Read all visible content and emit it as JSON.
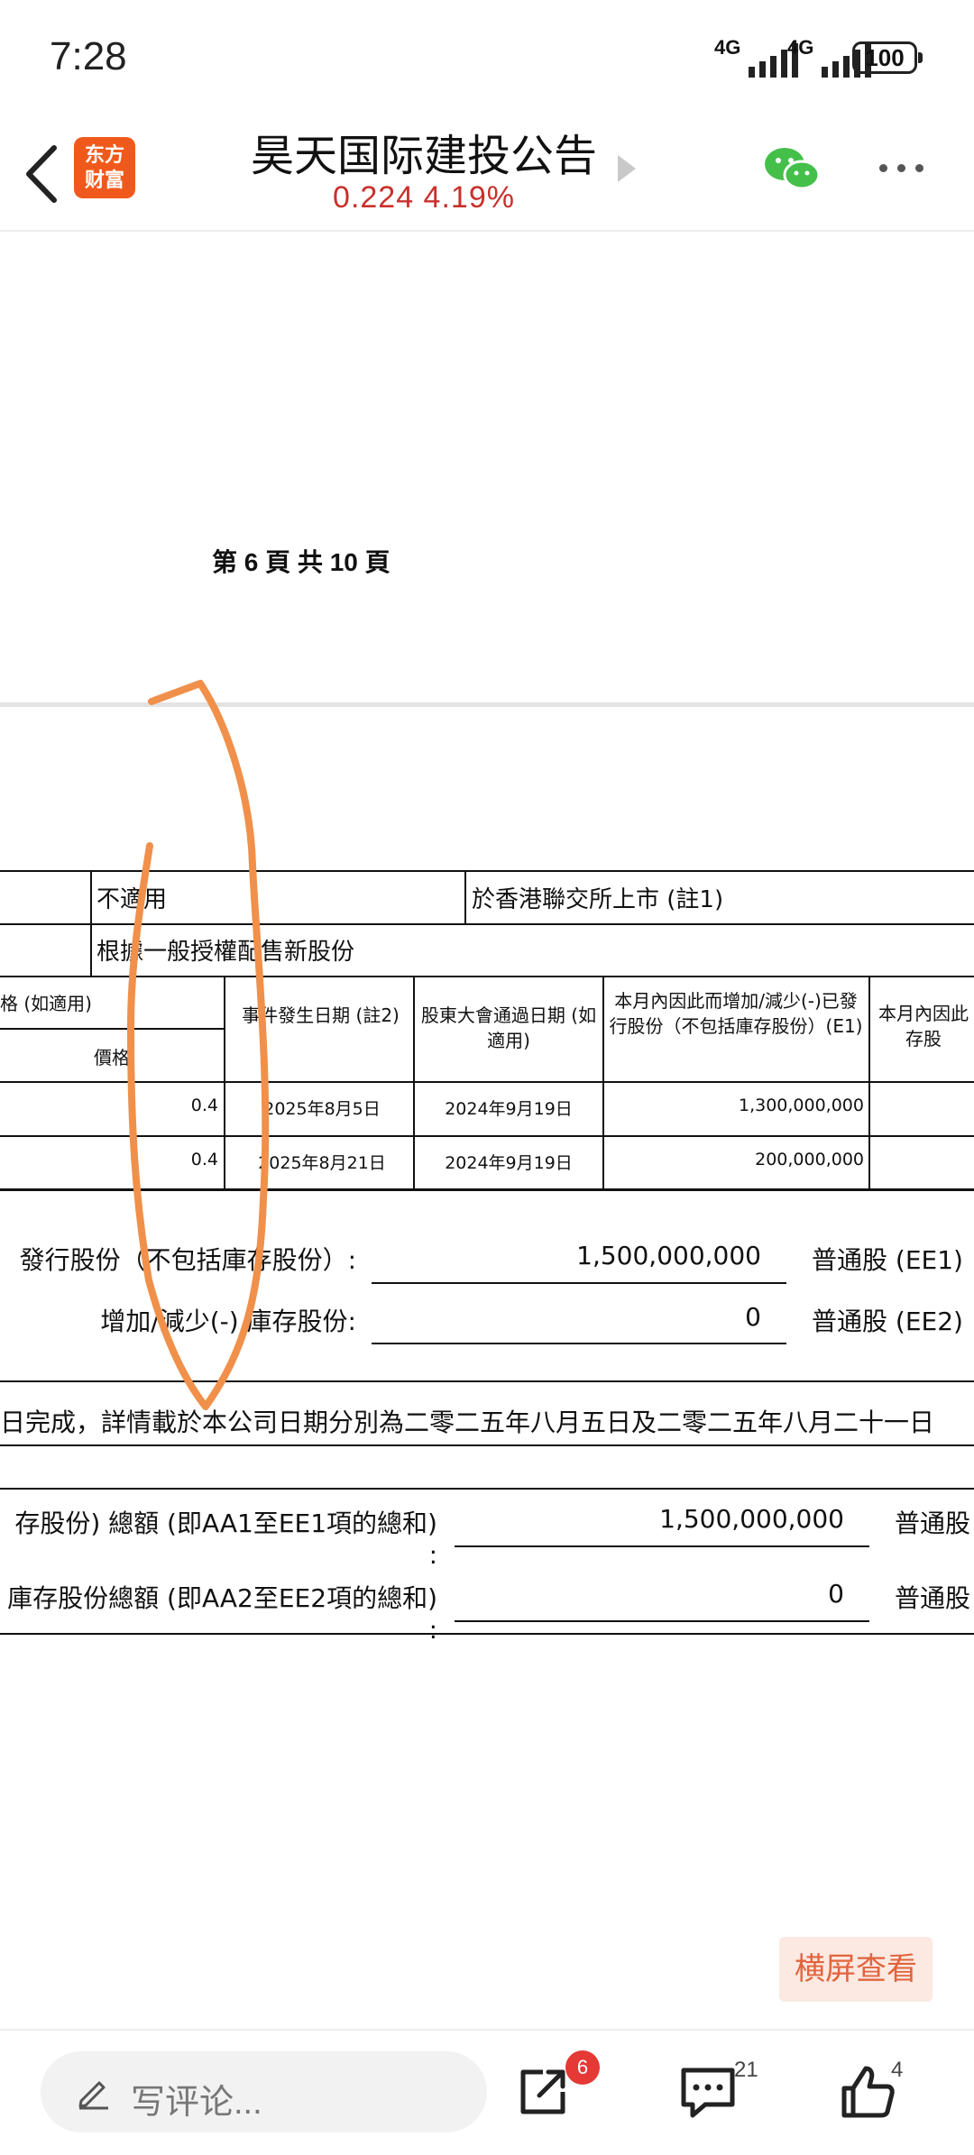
{
  "status_bar": {
    "time": "7:28",
    "signal1_label": "4G",
    "signal2_label": "4G",
    "battery": "100"
  },
  "header": {
    "logo_line1": "东方",
    "logo_line2": "财富",
    "title": "昊天国际建投公告",
    "quote": "0.224   4.19%"
  },
  "document": {
    "page_label": "第 6 頁 共 10 頁",
    "row1": {
      "a": "不適用",
      "b": "於香港聯交所上市 (註1)"
    },
    "row2": "根據一般授權配售新股份",
    "headers": {
      "price_group": "格 (如適用)",
      "price": "價格",
      "event_date": "事件發生日期 (註2)",
      "agm_date": "股東大會通過日期 (如適用)",
      "change": "本月內因此而增加/減少(-)已發行股份（不包括庫存股份）(E1)",
      "change_treasury": "本月內因此 存股"
    },
    "rows": [
      {
        "price": "0.4",
        "event_date": "2025年8月5日",
        "agm_date": "2024年9月19日",
        "change": "1,300,000,000"
      },
      {
        "price": "0.4",
        "event_date": "2025年8月21日",
        "agm_date": "2024年9月19日",
        "change": "200,000,000"
      }
    ],
    "totals": [
      {
        "label": "發行股份（不包括庫存股份）:",
        "value": "1,500,000,000",
        "unit": "普通股 (EE1)"
      },
      {
        "label": "增加/減少(-) 庫存股份:",
        "value": "0",
        "unit": "普通股 (EE2)"
      }
    ],
    "note": "日完成，詳情載於本公司日期分別為二零二五年八月五日及二零二五年八月二十一日",
    "grand_totals": [
      {
        "label": "存股份) 總額 (即AA1至EE1項的總和) :",
        "value": "1,500,000,000",
        "unit": "普通股"
      },
      {
        "label": "庫存股份總額 (即AA2至EE2項的總和) :",
        "value": "0",
        "unit": "普通股"
      }
    ]
  },
  "landscape_button": "横屏查看",
  "bottom_bar": {
    "comment_placeholder": "写评论...",
    "share_badge": "6",
    "comments_count": "21",
    "likes_count": "4"
  },
  "colors": {
    "brand": "#ef5a1c",
    "quote_red": "#c8312c",
    "annotation": "#f0904a"
  }
}
